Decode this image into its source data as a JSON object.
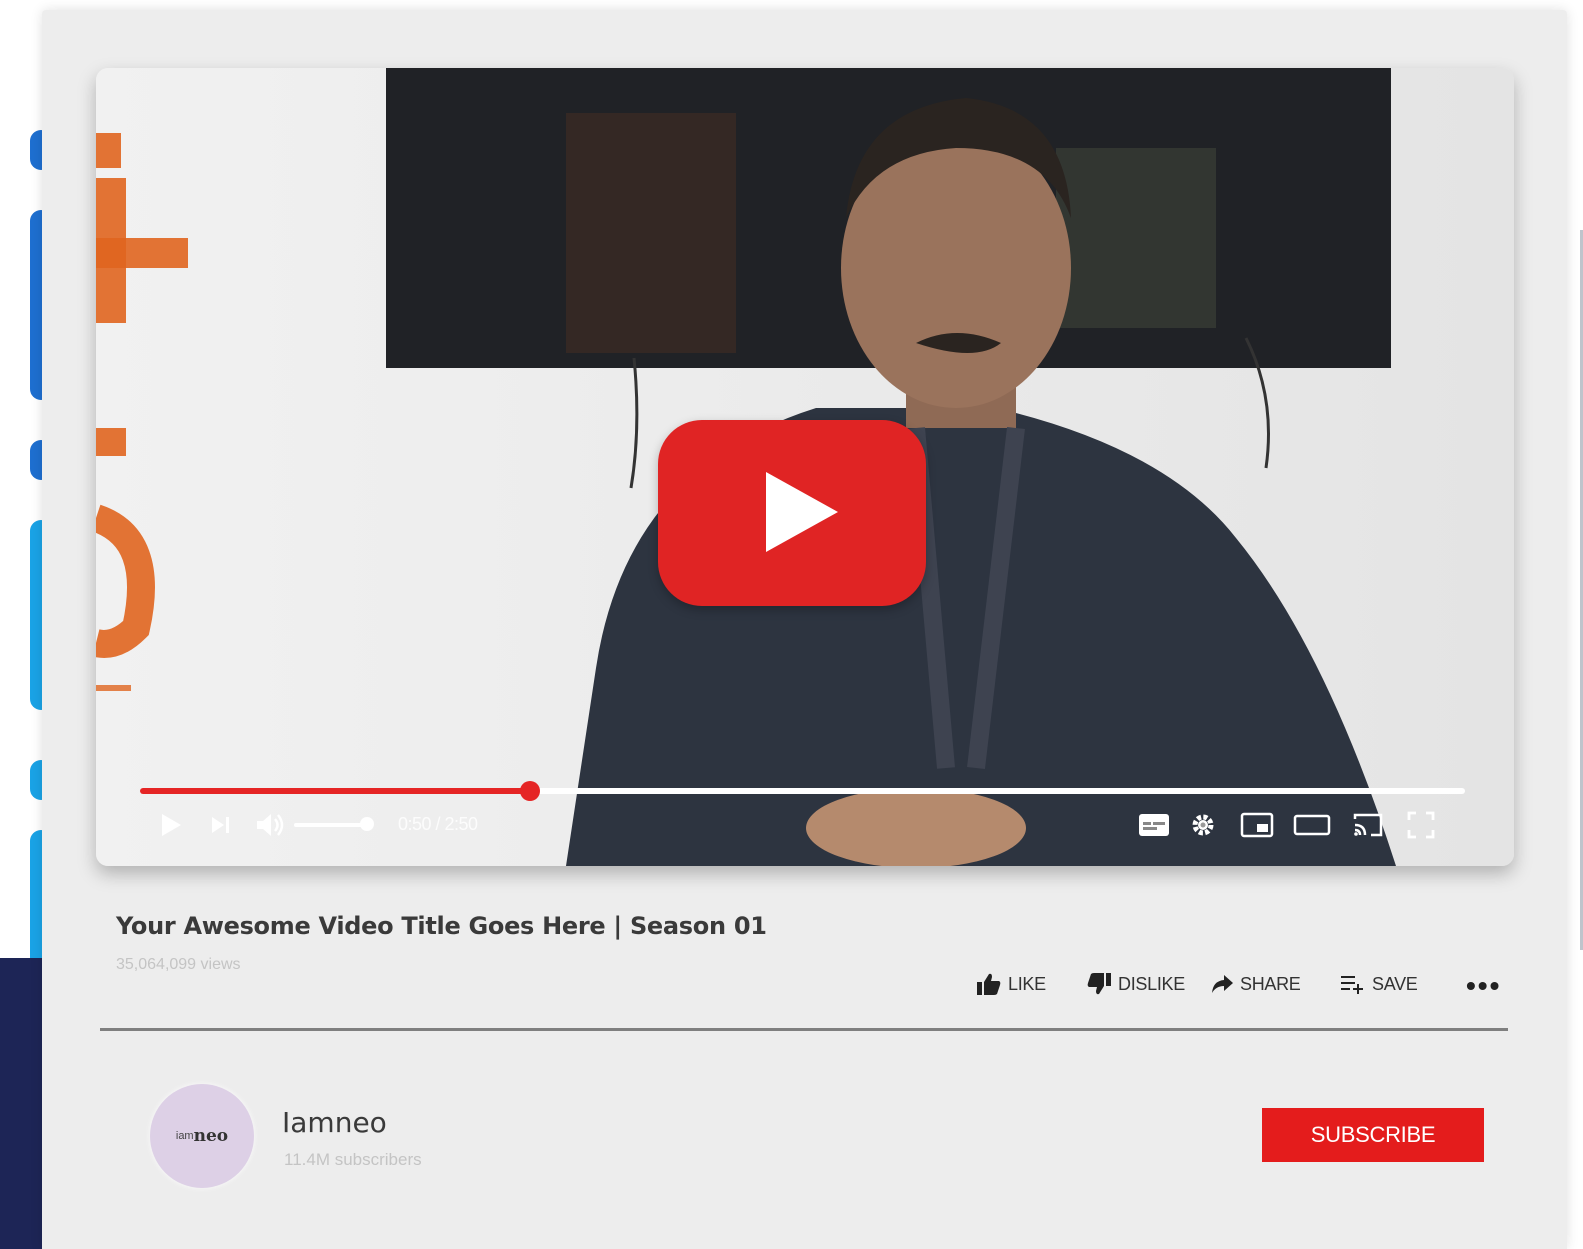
{
  "player": {
    "current_time": "0:50",
    "duration": "2:50",
    "time_display": "0:50 / 2:50",
    "progress_fraction": 0.294,
    "volume_fraction": 0.9
  },
  "video": {
    "title": "Your Awesome Video Title Goes Here | Season 01",
    "views": "35,064,099 views"
  },
  "actions": {
    "like": "LIKE",
    "dislike": "DISLIKE",
    "share": "SHARE",
    "save": "SAVE",
    "more": "•••"
  },
  "channel": {
    "avatar_prefix": "iam",
    "avatar_brand": "neo",
    "name": "Iamneo",
    "subscribers": "11.4M subscribers"
  },
  "subscribe_label": "SUBSCRIBE",
  "colors": {
    "brand_red": "#e41c1c",
    "progress_red": "#e52525",
    "card_bg": "#ededed"
  },
  "icons": [
    "play-icon",
    "next-icon",
    "volume-icon",
    "captions-icon",
    "settings-icon",
    "miniplayer-icon",
    "theater-icon",
    "cast-icon",
    "fullscreen-icon",
    "thumbs-up-icon",
    "thumbs-down-icon",
    "share-icon",
    "playlist-add-icon",
    "more-icon"
  ]
}
